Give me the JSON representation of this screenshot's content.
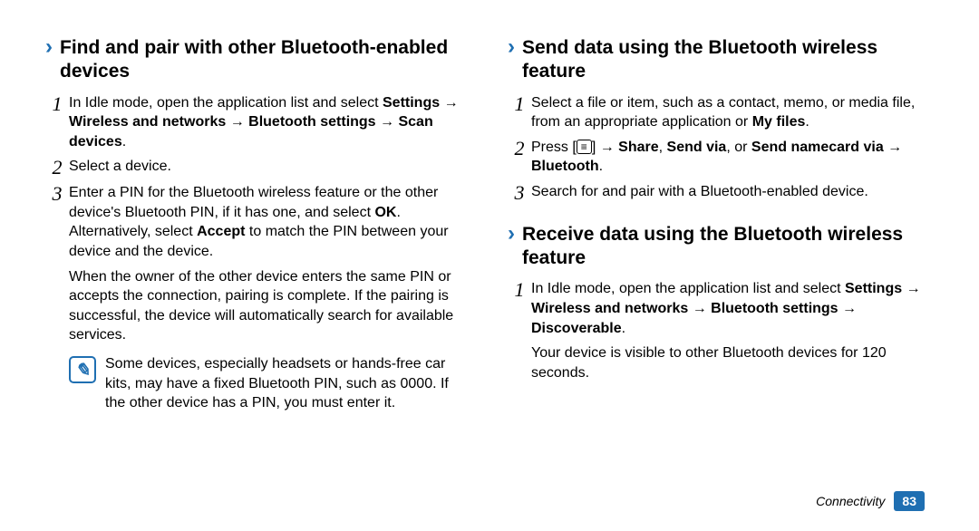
{
  "left": {
    "heading": "Find and pair with other Bluetooth-enabled devices",
    "steps": [
      {
        "num": "1",
        "prefix": "In Idle mode, open the application list and select ",
        "bold": "Settings → Wireless and networks → Bluetooth settings → Scan devices",
        "suffix": "."
      },
      {
        "num": "2",
        "text": "Select a device."
      },
      {
        "num": "3",
        "p1_a": "Enter a PIN for the Bluetooth wireless feature or the other device's Bluetooth PIN, if it has one, and select ",
        "p1_b": "OK",
        "p1_c": ". Alternatively, select ",
        "p1_d": "Accept",
        "p1_e": " to match the PIN between your device and the device.",
        "p2": "When the owner of the other device enters the same PIN or accepts the connection, pairing is complete. If the pairing is successful, the device will automatically search for available services."
      }
    ],
    "note": "Some devices, especially headsets or hands-free car kits, may have a fixed Bluetooth PIN, such as 0000. If the other device has a PIN, you must enter it."
  },
  "right": {
    "sectionA": {
      "heading": "Send data using the Bluetooth wireless feature",
      "steps": [
        {
          "num": "1",
          "a": "Select a file or item, such as a contact, memo, or media file, from an appropriate application or ",
          "b": "My files",
          "c": "."
        },
        {
          "num": "2",
          "a": "Press [",
          "icon": "≡",
          "b": "] → ",
          "bold1": "Share",
          "mid1": ", ",
          "bold2": "Send via",
          "mid2": ", or ",
          "bold3": "Send namecard via → Bluetooth",
          "end": "."
        },
        {
          "num": "3",
          "text": "Search for and pair with a Bluetooth-enabled device."
        }
      ]
    },
    "sectionB": {
      "heading": "Receive data using the Bluetooth wireless feature",
      "steps": [
        {
          "num": "1",
          "a": "In Idle mode, open the application list and select ",
          "bold": "Settings → Wireless and networks → Bluetooth settings → Discoverable",
          "b": ".",
          "p2": "Your device is visible to other Bluetooth devices for 120 seconds."
        }
      ]
    }
  },
  "footer": {
    "label": "Connectivity",
    "page": "83"
  },
  "chart_data": null
}
